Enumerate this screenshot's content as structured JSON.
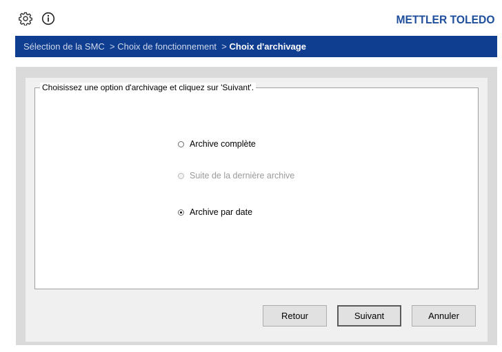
{
  "header": {
    "brand": "METTLER TOLEDO",
    "icons": [
      "gear-icon",
      "info-icon"
    ],
    "brand_color": "#1f4e9c"
  },
  "breadcrumb": {
    "items": [
      "Sélection de la SMC",
      "Choix de fonctionnement",
      "Choix d'archivage"
    ],
    "separator": ">",
    "bar_color": "#0f3e91"
  },
  "group": {
    "legend": "Choisissez une option d'archivage et cliquez sur 'Suivant'."
  },
  "options": [
    {
      "label": "Archive complète",
      "selected": false,
      "enabled": true
    },
    {
      "label": "Suite de la dernière archive",
      "selected": false,
      "enabled": false
    },
    {
      "label": "Archive par date",
      "selected": true,
      "enabled": true
    }
  ],
  "buttons": {
    "back": "Retour",
    "next": "Suivant",
    "cancel": "Annuler"
  }
}
